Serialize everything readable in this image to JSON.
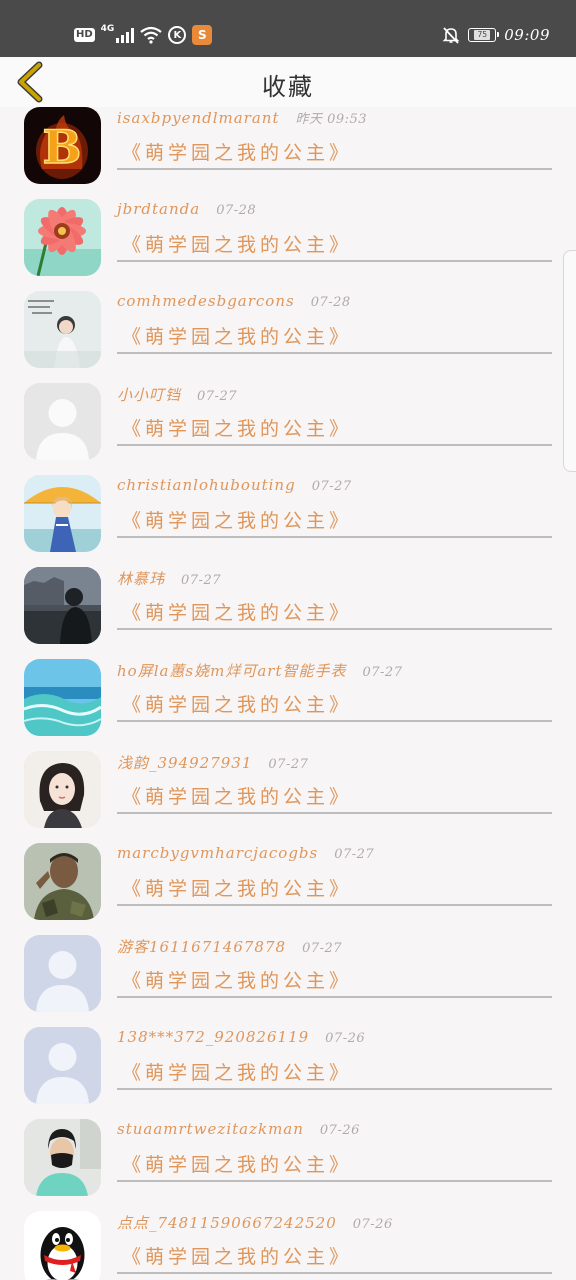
{
  "status_bar": {
    "hd": "HD",
    "network": "4G",
    "k_icon": "K",
    "app_badge": "S",
    "battery": "75",
    "time": "09:09"
  },
  "header": {
    "title": "收藏"
  },
  "items": [
    {
      "user": "isaxbpyendlmarant",
      "time": "昨天 09:53",
      "book": "《萌学园之我的公主》",
      "avatar": "fire-letter-b",
      "avatar_label": "B"
    },
    {
      "user": "jbrdtanda",
      "time": "07-28",
      "book": "《萌学园之我的公主》",
      "avatar": "pink-flower"
    },
    {
      "user": "comhmedesbgarcons",
      "time": "07-28",
      "book": "《萌学园之我的公主》",
      "avatar": "girl-text-photo"
    },
    {
      "user": "小小叮铛",
      "time": "07-27",
      "book": "《萌学园之我的公主》",
      "avatar": "default-grey"
    },
    {
      "user": "christianlohubouting",
      "time": "07-27",
      "book": "《萌学园之我的公主》",
      "avatar": "anime-girl-umbrella"
    },
    {
      "user": "林慕玮",
      "time": "07-27",
      "book": "《萌学园之我的公主》",
      "avatar": "dark-silhouette"
    },
    {
      "user": "ho屏la蕙s娆m烊可art智能手表",
      "time": "07-27",
      "book": "《萌学园之我的公主》",
      "avatar": "ocean-wave"
    },
    {
      "user": "浅韵_394927931",
      "time": "07-27",
      "book": "《萌学园之我的公主》",
      "avatar": "girl-portrait"
    },
    {
      "user": "marcbygvmharcjacogbs",
      "time": "07-27",
      "book": "《萌学园之我的公主》",
      "avatar": "soldier"
    },
    {
      "user": "游客1611671467878",
      "time": "07-27",
      "book": "《萌学园之我的公主》",
      "avatar": "default-blue"
    },
    {
      "user": "138***372_920826119",
      "time": "07-26",
      "book": "《萌学园之我的公主》",
      "avatar": "default-blue"
    },
    {
      "user": "stuaamrtwezitazkman",
      "time": "07-26",
      "book": "《萌学园之我的公主》",
      "avatar": "man-mask"
    },
    {
      "user": "点点_74811590667242520",
      "time": "07-26",
      "book": "《萌学园之我的公主》",
      "avatar": "qq-penguin"
    }
  ],
  "colors": {
    "accent": "#e0965a",
    "status_bar": "#4a4a4a",
    "background": "#f7f5f6",
    "back_arrow": "#c9a300"
  },
  "icons": {
    "back": "chevron-left-icon",
    "wifi": "wifi-icon",
    "bell_off": "bell-off-icon"
  }
}
